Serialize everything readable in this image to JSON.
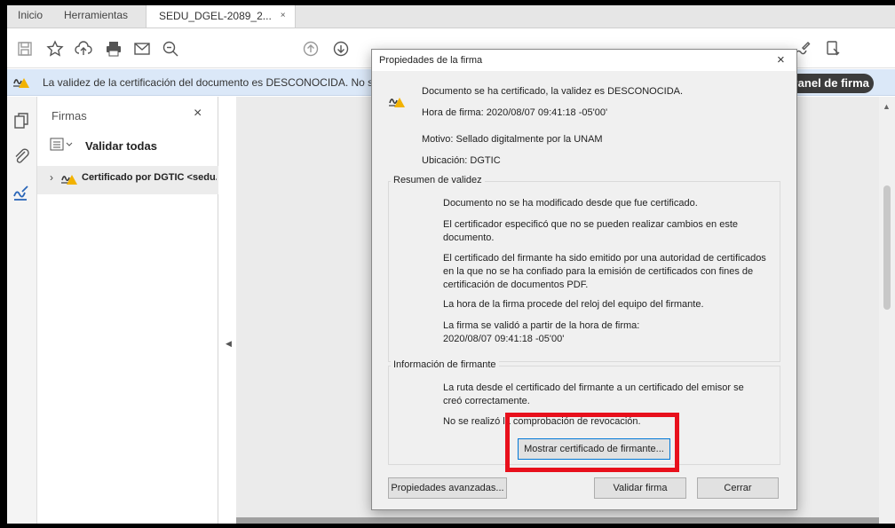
{
  "tabs": {
    "home": "Inicio",
    "tools": "Herramientas",
    "document": "SEDU_DGEL-2089_2...",
    "document_close": "×"
  },
  "infobar": {
    "message": "La validez de la certificación del documento es DESCONOCIDA. No se p",
    "panel_button": "Panel de firma",
    "bg_color": "#dbe8f8"
  },
  "sig_panel": {
    "title": "Firmas",
    "close": "×",
    "validate_all": "Validar todas",
    "signature_item": "Certificado por DGTIC <sedu.dgtic@unam.mx>",
    "expand": "›"
  },
  "dialog": {
    "title": "Propiedades de la firma",
    "close": "×",
    "status": "Documento se ha certificado, la validez es DESCONOCIDA.",
    "signing_time": "Hora de firma:  2020/08/07 09:41:18 -05'00'",
    "reason": "Motivo:  Sellado digitalmente por la UNAM",
    "location": "Ubicación:  DGTIC",
    "validity_summary": {
      "label": "Resumen de validez",
      "items": [
        "Documento no se ha modificado desde que fue certificado.",
        "El certificador especificó que no se pueden realizar cambios en este documento.",
        "El certificado del firmante ha sido emitido por una autoridad de certificados en la que no se ha confiado para la emisión de certificados con fines de certificación de documentos PDF.",
        "La hora de la firma procede del reloj del equipo del firmante.",
        "La firma se validó a partir de la hora de firma:\n2020/08/07 09:41:18 -05'00'"
      ]
    },
    "signer_info": {
      "label": "Información de firmante",
      "path_text": "La ruta desde el certificado del firmante a un certificado del emisor se creó correctamente.",
      "revocation_text": "No se realizó la comprobación de revocación.",
      "show_cert_button": "Mostrar certificado de firmante..."
    },
    "buttons": {
      "advanced": "Propiedades avanzadas...",
      "validate": "Validar firma",
      "close": "Cerrar"
    }
  },
  "annotation": {
    "highlight_color": "#e8101c"
  }
}
